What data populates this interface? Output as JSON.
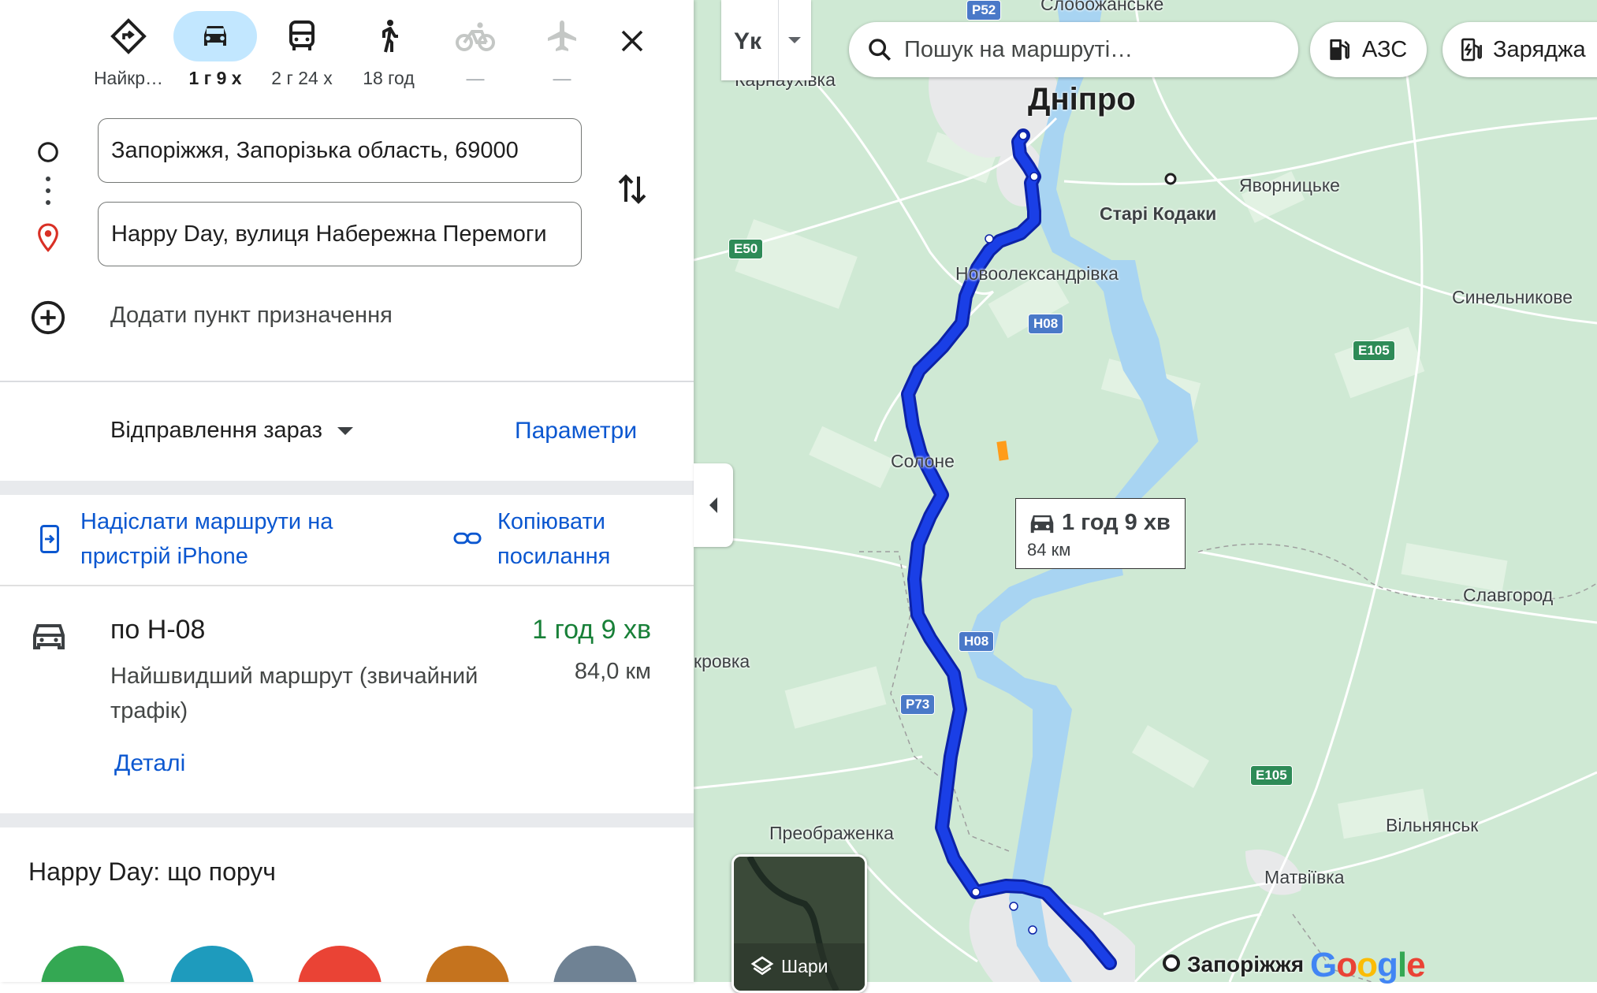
{
  "travel_modes": [
    {
      "name": "best",
      "label": "Найкр…",
      "icon": "route-diamond-icon",
      "active": false
    },
    {
      "name": "car",
      "label": "1 г 9 х",
      "icon": "car-icon",
      "active": true
    },
    {
      "name": "transit",
      "label": "2 г 24 х",
      "icon": "bus-icon",
      "active": false
    },
    {
      "name": "walk",
      "label": "18 год",
      "icon": "walking-icon",
      "active": false
    },
    {
      "name": "bike",
      "label": "—",
      "icon": "bicycle-icon",
      "active": false
    },
    {
      "name": "flight",
      "label": "—",
      "icon": "airplane-icon",
      "active": false
    }
  ],
  "waypoints": {
    "origin": "Запоріжжя, Запорізька область, 69000",
    "destination": "Happy Day, вулиця Набережна Перемоги"
  },
  "add_destination": "Додати пункт призначення",
  "depart": {
    "label": "Відправлення зараз",
    "options_label": "Параметри"
  },
  "actions": {
    "send_line1": "Надіслати маршрути на",
    "send_line2": "пристрій iPhone",
    "copy_line1": "Копіювати",
    "copy_line2": "посилання"
  },
  "route": {
    "name": "по Н-08",
    "time": "1 год 9 хв",
    "description": "Найшвидший маршрут (звичайний трафік)",
    "distance": "84,0 км",
    "details_label": "Деталі"
  },
  "nearby_title": "Happy Day: що поруч",
  "map": {
    "language_label": "Yк",
    "search_placeholder": "Пошук на маршруті…",
    "chips": [
      "АЗС",
      "Заряджа"
    ],
    "callout": {
      "time": "1 год 9 хв",
      "distance": "84 км"
    },
    "layers_label": "Шари",
    "brand": "Google",
    "places": [
      {
        "name": "Дніпро",
        "cls": "city"
      },
      {
        "name": "Слобожанське"
      },
      {
        "name": "Карнаухівка"
      },
      {
        "name": "Старі Кодаки"
      },
      {
        "name": "Яворницьке"
      },
      {
        "name": "Новоолександрівка"
      },
      {
        "name": "Синельникове"
      },
      {
        "name": "Солоне"
      },
      {
        "name": "Славгород"
      },
      {
        "name": "кровка"
      },
      {
        "name": "Преображенка"
      },
      {
        "name": "Вільнянськ"
      },
      {
        "name": "Матвіївка"
      },
      {
        "name": "Запоріжжя"
      }
    ],
    "road_shields": [
      "Р52",
      "E50",
      "H08",
      "E105",
      "H08",
      "P73",
      "E105"
    ],
    "colors": {
      "route": "#1a3fe6",
      "route_outline": "#0c22a8",
      "water": "#a8d4f2",
      "land": "#cfe9d4",
      "accent": "#0b57d0"
    }
  }
}
